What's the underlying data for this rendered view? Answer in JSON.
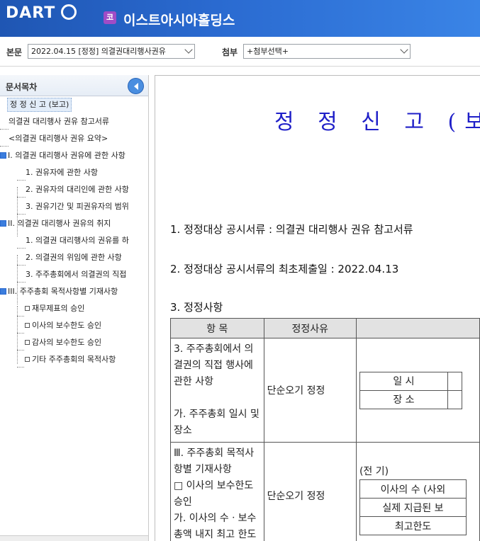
{
  "header": {
    "logo_text": "DART",
    "company_badge": "코",
    "company_name": "이스트아시아홀딩스"
  },
  "toolbar": {
    "main_label": "본문",
    "main_value": "2022.04.15 [정정] 의결권대리행사권유",
    "attach_label": "첨부",
    "attach_value": "+첨부선택+"
  },
  "sidebar": {
    "title": "문서목차",
    "items": [
      "정 정 신 고 (보고)",
      "의결권 대리행사 권유 참고서류",
      "<의결권 대리행사 권유 요약>",
      "I. 의결권 대리행사 권유에 관한 사항",
      "1. 권유자에 관한 사항",
      "2. 권유자의 대리인에 관한 사항",
      "3. 권유기간 및 피권유자의 범위",
      "II. 의결권 대리행사 권유의 취지",
      "1. 의결권 대리행사의 권유를 하",
      "2. 의결권의 위임에 관한 사항",
      "3. 주주총회에서 의결권의 직접",
      "III. 주주총회 목적사항별 기재사항",
      "재무제표의 승인",
      "이사의 보수한도 승인",
      "감사의 보수한도 승인",
      "기타 주주총회의 목적사항"
    ]
  },
  "document": {
    "title": "정 정 신 고 (보고)",
    "para1": "1. 정정대상 공시서류 : 의결권 대리행사 권유 참고서류",
    "para2": "2. 정정대상 공시서류의 최초제출일 : 2022.04.13",
    "para3": "3. 정정사항",
    "table": {
      "headers": [
        "항 목",
        "정정사유",
        ""
      ],
      "row1": {
        "item_lines": [
          "3. 주주총회에서 의",
          "결권의 직접 행사에",
          "관한 사항",
          "",
          "가. 주주총회 일시 및",
          "장소"
        ],
        "reason": "단순오기 정정",
        "inner": [
          "일 시",
          "장 소"
        ]
      },
      "row2": {
        "item_lines": [
          "Ⅲ. 주주총회 목적사",
          "항별 기재사항",
          "□ 이사의 보수한도",
          "승인",
          "가. 이사의 수ㆍ보수",
          "총액 내지 최고 한도"
        ],
        "reason": "단순오기 정정",
        "period": "(전 기)",
        "inner": [
          "이사의 수 (사외",
          "실제 지급된 보",
          "최고한도"
        ]
      }
    }
  }
}
